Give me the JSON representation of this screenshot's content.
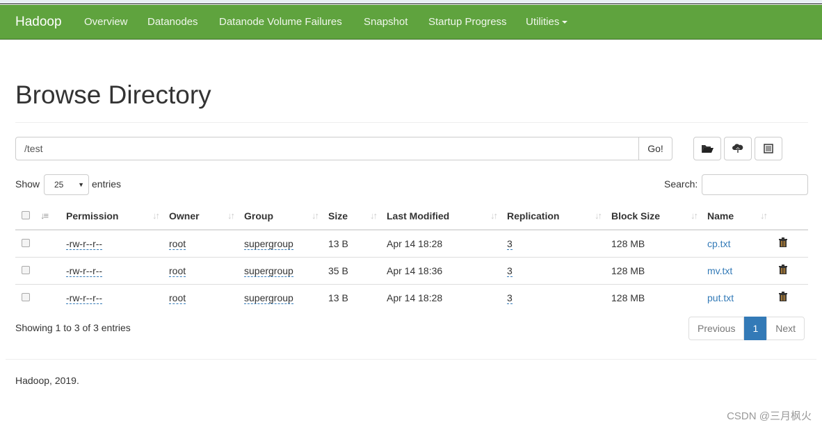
{
  "nav": {
    "brand": "Hadoop",
    "items": [
      "Overview",
      "Datanodes",
      "Datanode Volume Failures",
      "Snapshot",
      "Startup Progress",
      "Utilities"
    ]
  },
  "page_title": "Browse Directory",
  "path_input": {
    "value": "/test"
  },
  "go_label": "Go!",
  "toolbar": {
    "icons": [
      "folder-open-icon",
      "cloud-upload-icon",
      "list-icon"
    ]
  },
  "show_label": "Show",
  "page_size": "25",
  "entries_label": "entries",
  "search_label": "Search:",
  "columns": [
    "Permission",
    "Owner",
    "Group",
    "Size",
    "Last Modified",
    "Replication",
    "Block Size",
    "Name"
  ],
  "rows": [
    {
      "permission": "-rw-r--r--",
      "owner": "root",
      "group": "supergroup",
      "size": "13 B",
      "modified": "Apr 14 18:28",
      "replication": "3",
      "block_size": "128 MB",
      "name": "cp.txt"
    },
    {
      "permission": "-rw-r--r--",
      "owner": "root",
      "group": "supergroup",
      "size": "35 B",
      "modified": "Apr 14 18:36",
      "replication": "3",
      "block_size": "128 MB",
      "name": "mv.txt"
    },
    {
      "permission": "-rw-r--r--",
      "owner": "root",
      "group": "supergroup",
      "size": "13 B",
      "modified": "Apr 14 18:28",
      "replication": "3",
      "block_size": "128 MB",
      "name": "put.txt"
    }
  ],
  "info": "Showing 1 to 3 of 3 entries",
  "pagination": {
    "previous": "Previous",
    "current": "1",
    "next": "Next"
  },
  "footer": "Hadoop, 2019.",
  "watermark": "CSDN @三月枫火",
  "colors": {
    "navbar": "#5fa33e",
    "link": "#337ab7"
  }
}
